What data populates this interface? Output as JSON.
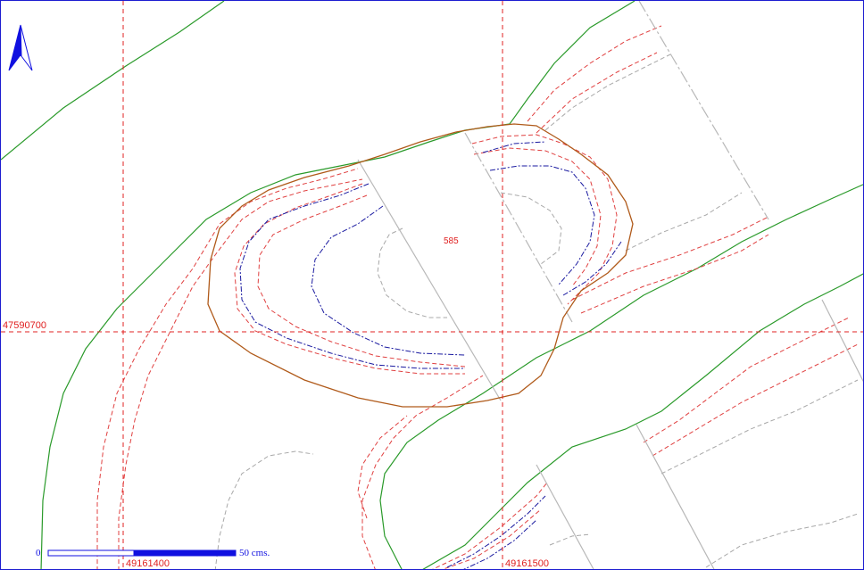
{
  "map": {
    "grid_labels": {
      "x1": "49161400",
      "x2": "49161500",
      "y1": "47590700"
    },
    "parcel_label": "585",
    "scale_bar": {
      "start_label": "0",
      "end_label": "50 cms."
    },
    "north_arrow_icon": "north-arrow-icon",
    "colors": {
      "grid": "#e02020",
      "river_bank": "#2a9a2a",
      "contour_red": "#e04040",
      "contour_gray": "#a8a8a8",
      "contour_blue": "#1a1aa0",
      "parcel_outline": "#b05a1a",
      "frame": "#1c1cd0",
      "scale_bar": "#1010e0"
    }
  }
}
